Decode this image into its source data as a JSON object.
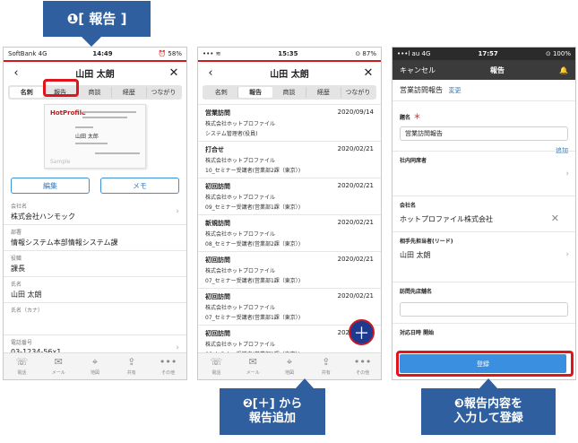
{
  "callouts": {
    "step1": "❶[ 報告 ]",
    "step2_line1": "❷[＋] から",
    "step2_line2": "報告追加",
    "step3_line1": "❸報告内容を",
    "step3_line2": "入力して登録"
  },
  "colors": {
    "accent_red": "#e0141c",
    "callout_blue": "#2f5f9e",
    "link_blue": "#2d7bc6",
    "fab_navy": "#1e3a8f",
    "submit_blue": "#3a8fe0"
  },
  "phone1": {
    "status": {
      "carrier": "SoftBank 4G",
      "time": "14:49",
      "battery": "⏰ 58%"
    },
    "nav": {
      "back": "‹",
      "title": "山田 太朗",
      "close": "✕"
    },
    "tabs": [
      "名刺",
      "報告",
      "商談",
      "経歴",
      "つながり"
    ],
    "card": {
      "logo": "HotProfile",
      "name": "山田 太郎",
      "sample": "Sample"
    },
    "buttons": {
      "edit": "編集",
      "memo": "メモ"
    },
    "fields": [
      {
        "label": "会社名",
        "value": "株式会社ハンモック",
        "chevron": "›"
      },
      {
        "label": "部署",
        "value": "情報システム本部情報システム課",
        "chevron": ""
      },
      {
        "label": "役職",
        "value": "課長",
        "chevron": ""
      },
      {
        "label": "氏名",
        "value": "山田 太朗",
        "chevron": ""
      },
      {
        "label": "氏名（カナ）",
        "value": "",
        "chevron": ""
      },
      {
        "label": "電話番号",
        "value": "03-1234-56x1",
        "chevron": "›"
      }
    ],
    "tabbar": [
      {
        "icon": "phone-icon",
        "glyph": "☏",
        "label": "電話"
      },
      {
        "icon": "mail-icon",
        "glyph": "✉",
        "label": "メール"
      },
      {
        "icon": "map-pin-icon",
        "glyph": "⌖",
        "label": "地図"
      },
      {
        "icon": "share-icon",
        "glyph": "⇪",
        "label": "共有"
      },
      {
        "icon": "more-icon",
        "glyph": "•••",
        "label": "その他"
      }
    ]
  },
  "phone2": {
    "status": {
      "carrier": "•••  ≋",
      "time": "15:35",
      "battery": "⊙ 87%"
    },
    "nav": {
      "back": "‹",
      "title": "山田 太朗",
      "close": "✕"
    },
    "tabs": [
      "名刺",
      "報告",
      "商談",
      "経歴",
      "つながり"
    ],
    "reports": [
      {
        "type": "営業訪問",
        "date": "2020/09/14",
        "company": "株式会社ホットプロファイル",
        "detail": "システム管理者(役員)"
      },
      {
        "type": "打合せ",
        "date": "2020/02/21",
        "company": "株式会社ホットプロファイル",
        "detail": "10_セミナー受講者(営業部2課（東京）)"
      },
      {
        "type": "初回訪問",
        "date": "2020/02/21",
        "company": "株式会社ホットプロファイル",
        "detail": "09_セミナー受講者(営業部1課（東京）)"
      },
      {
        "type": "新規訪問",
        "date": "2020/02/21",
        "company": "株式会社ホットプロファイル",
        "detail": "08_セミナー受講者(営業部2課（東京）)"
      },
      {
        "type": "初回訪問",
        "date": "2020/02/21",
        "company": "株式会社ホットプロファイル",
        "detail": "07_セミナー受講者(営業部1課（東京）)"
      },
      {
        "type": "初回訪問",
        "date": "2020/02/21",
        "company": "株式会社ホットプロファイル",
        "detail": "07_セミナー受講者(営業部1課（東京）)"
      },
      {
        "type": "初回訪問",
        "date": "2020/02/21",
        "company": "株式会社ホットプロファイル",
        "detail": "06_セミナー受講者(営業部2課（東京）)"
      }
    ],
    "fab": "＋",
    "tabbar": [
      {
        "icon": "phone-icon",
        "glyph": "☏",
        "label": "電話"
      },
      {
        "icon": "mail-icon",
        "glyph": "✉",
        "label": "メール"
      },
      {
        "icon": "map-pin-icon",
        "glyph": "⌖",
        "label": "地図"
      },
      {
        "icon": "share-icon",
        "glyph": "⇪",
        "label": "共有"
      },
      {
        "icon": "more-icon",
        "glyph": "•••",
        "label": "その他"
      }
    ]
  },
  "phone3": {
    "status": {
      "carrier": "•••l au 4G",
      "time": "17:57",
      "battery": "⊙ 100%"
    },
    "nav": {
      "cancel": "キャンセル",
      "title": "報告",
      "bell": "🔔"
    },
    "header": {
      "title": "営業訪問報告",
      "change": "変更"
    },
    "title_field": {
      "label": "題名",
      "required": "＊",
      "value": "営業訪問報告",
      "add": "追加"
    },
    "colleague": {
      "label": "社内同席者",
      "chevron": "›"
    },
    "company": {
      "label": "会社名",
      "value": "ホットプロファイル株式会社",
      "clear": "✕"
    },
    "contact": {
      "label": "相手先担当者(リード)",
      "value": "山田 太朗",
      "chevron": "›"
    },
    "store": {
      "label": "訪問先店舗名",
      "value": ""
    },
    "datetime": {
      "label": "対応日時  開始"
    },
    "submit": "登録"
  }
}
